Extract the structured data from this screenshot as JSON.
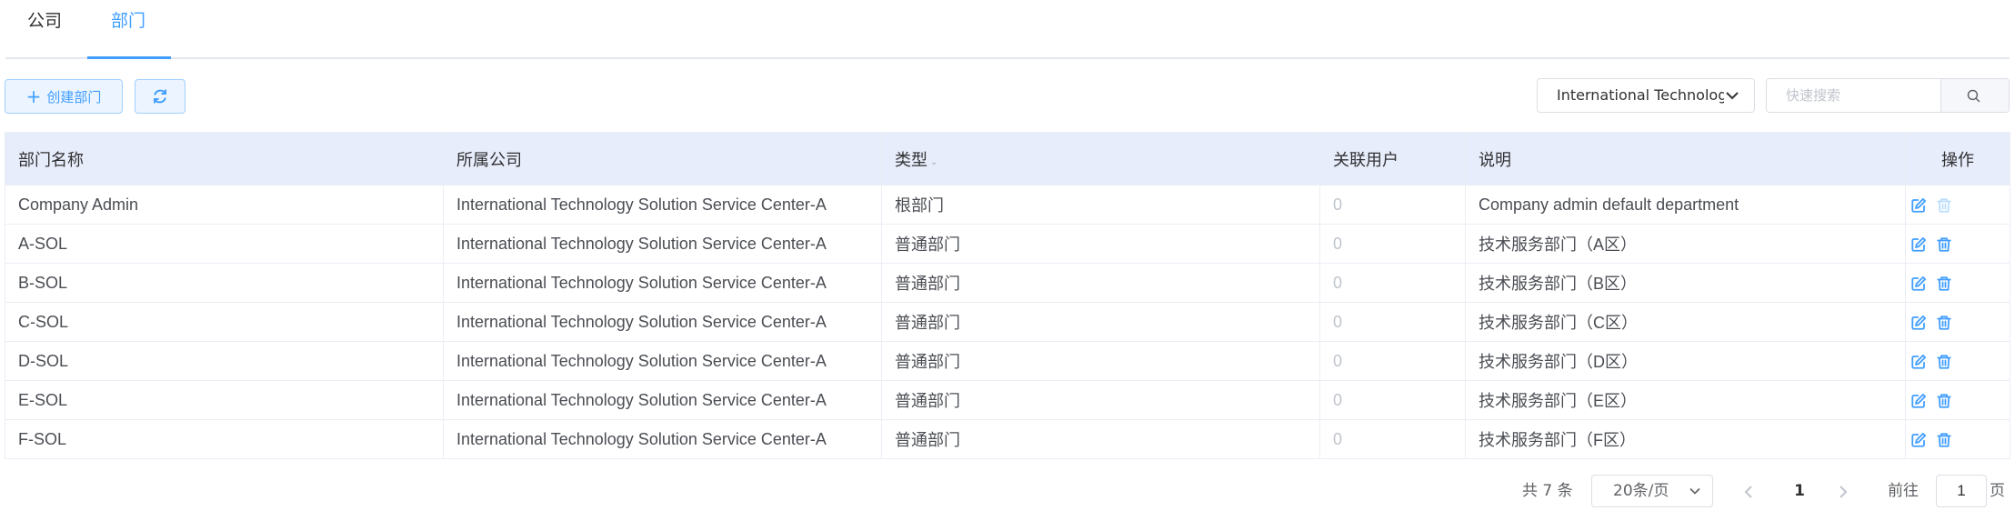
{
  "tabs": [
    {
      "label": "公司",
      "active": false
    },
    {
      "label": "部门",
      "active": true
    }
  ],
  "toolbar": {
    "create_label": "创建部门",
    "company_select_value": "International Technology Solution Service Center-A",
    "search_placeholder": "快速搜索"
  },
  "table": {
    "headers": [
      "部门名称",
      "所属公司",
      "类型",
      "关联用户",
      "说明",
      "操作"
    ],
    "rows": [
      {
        "name": "Company Admin",
        "company": "International Technology Solution Service Center-A",
        "type": "根部门",
        "users": "0",
        "desc": "Company admin default department",
        "delete_disabled": true
      },
      {
        "name": "A-SOL",
        "company": "International Technology Solution Service Center-A",
        "type": "普通部门",
        "users": "0",
        "desc": "技术服务部门（A区）",
        "delete_disabled": false
      },
      {
        "name": "B-SOL",
        "company": "International Technology Solution Service Center-A",
        "type": "普通部门",
        "users": "0",
        "desc": "技术服务部门（B区）",
        "delete_disabled": false
      },
      {
        "name": "C-SOL",
        "company": "International Technology Solution Service Center-A",
        "type": "普通部门",
        "users": "0",
        "desc": "技术服务部门（C区）",
        "delete_disabled": false
      },
      {
        "name": "D-SOL",
        "company": "International Technology Solution Service Center-A",
        "type": "普通部门",
        "users": "0",
        "desc": "技术服务部门（D区）",
        "delete_disabled": false
      },
      {
        "name": "E-SOL",
        "company": "International Technology Solution Service Center-A",
        "type": "普通部门",
        "users": "0",
        "desc": "技术服务部门（E区）",
        "delete_disabled": false
      },
      {
        "name": "F-SOL",
        "company": "International Technology Solution Service Center-A",
        "type": "普通部门",
        "users": "0",
        "desc": "技术服务部门（F区）",
        "delete_disabled": false
      }
    ]
  },
  "pagination": {
    "total_label": "共 7 条",
    "page_size": "20条/页",
    "current_page": "1",
    "goto_label": "前往",
    "goto_value": "1",
    "goto_suffix": "页"
  },
  "icons": {
    "refresh": "refresh-icon",
    "dropdown": "chevron-down-icon",
    "search": "search-icon",
    "edit": "edit-icon",
    "delete": "trash-icon",
    "prev": "chevron-left-icon",
    "next": "chevron-right-icon"
  },
  "colors": {
    "primary": "#409eff",
    "header_bg": "#e8edfb",
    "border": "#ebeef5",
    "muted_text": "#c0c4cc"
  }
}
